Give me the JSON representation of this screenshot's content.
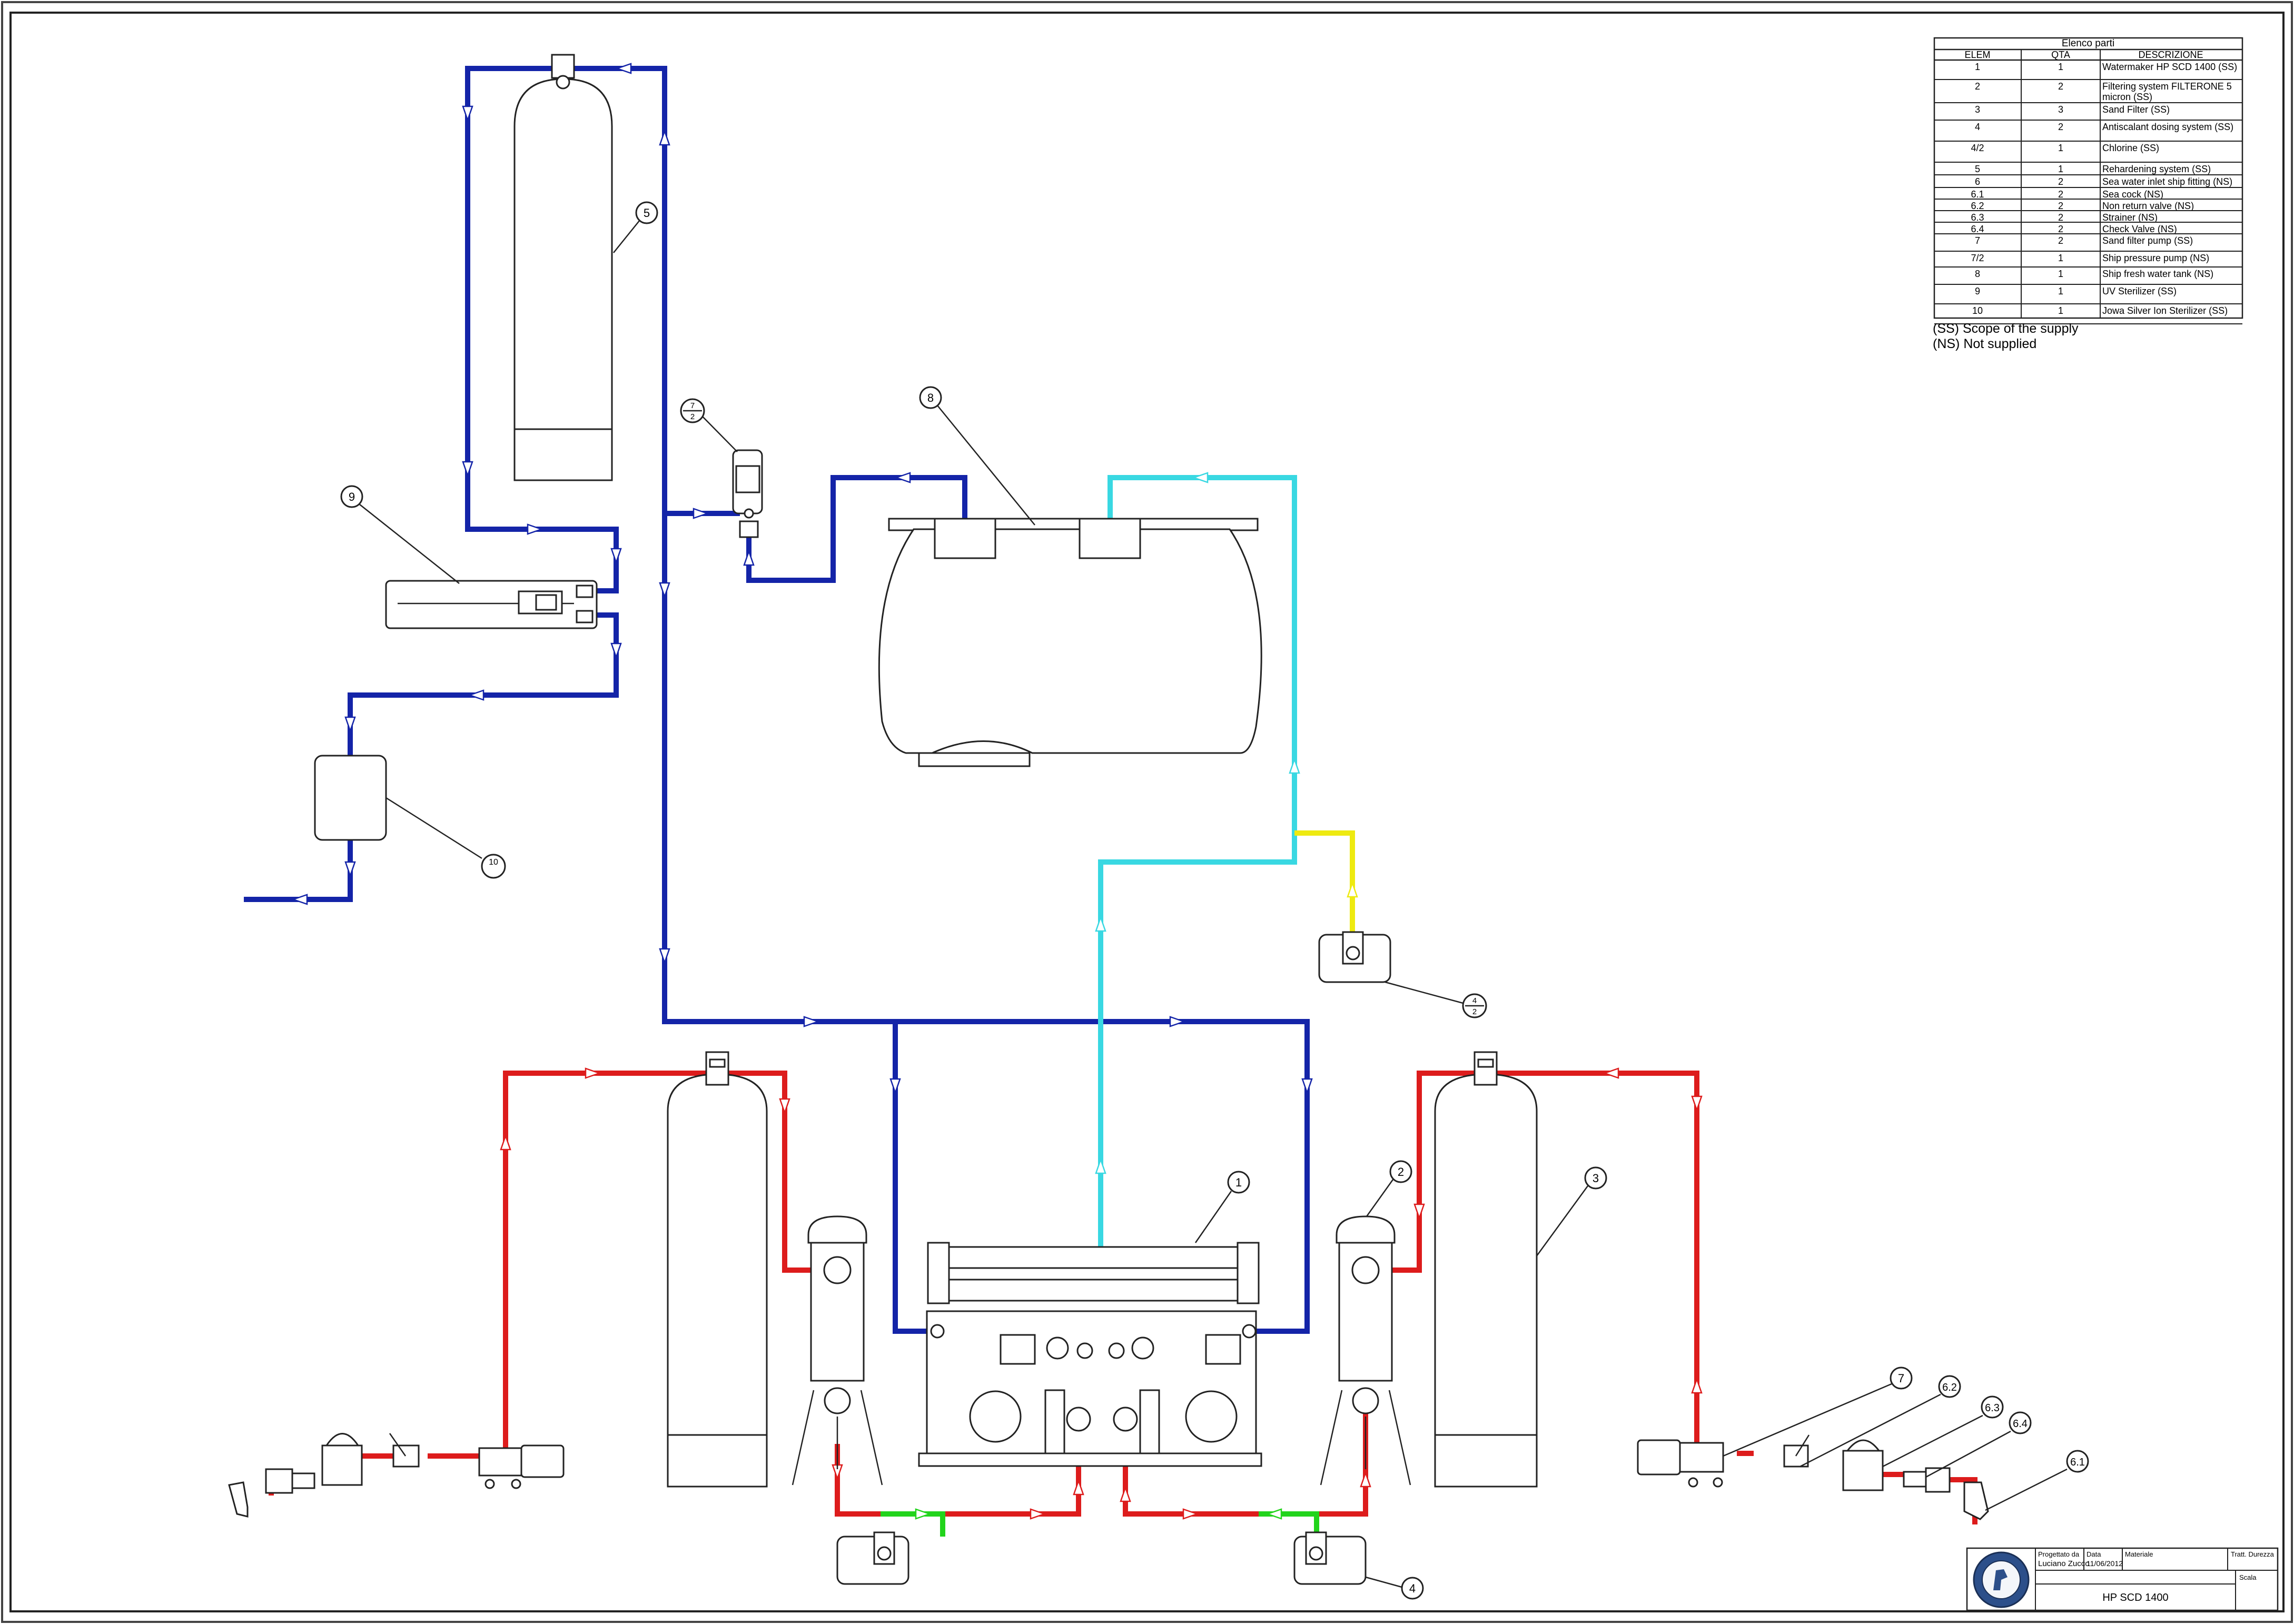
{
  "parts_table": {
    "title": "Elenco parti",
    "headers": [
      "ELEM",
      "QTA",
      "DESCRIZIONE"
    ],
    "rows": [
      {
        "elem": "1",
        "qta": "1",
        "desc": [
          "Watermaker HP SCD 1400  (SS)"
        ]
      },
      {
        "elem": "2",
        "qta": "2",
        "desc": [
          "Filtering system  FILTERONE 5",
          "micron  (SS)"
        ]
      },
      {
        "elem": "3",
        "qta": "3",
        "desc": [
          "Sand Filter  (SS)"
        ]
      },
      {
        "elem": "4",
        "qta": "2",
        "desc": [
          "Antiscalant dosing system  (SS)"
        ]
      },
      {
        "elem": "4/2",
        "qta": "1",
        "desc": [
          "Chlorine  (SS)"
        ]
      },
      {
        "elem": "5",
        "qta": "1",
        "desc": [
          "Rehardening system  (SS)"
        ]
      },
      {
        "elem": "6",
        "qta": "2",
        "desc": [
          "Sea water inlet ship fitting  (NS)"
        ]
      },
      {
        "elem": "6.1",
        "qta": "2",
        "desc": [
          "Sea cock  (NS)"
        ]
      },
      {
        "elem": "6.2",
        "qta": "2",
        "desc": [
          "Non return valve  (NS)"
        ]
      },
      {
        "elem": "6.3",
        "qta": "2",
        "desc": [
          " Strainer  (NS)"
        ]
      },
      {
        "elem": "6.4",
        "qta": "2",
        "desc": [
          "Check Valve  (NS)"
        ]
      },
      {
        "elem": "7",
        "qta": "2",
        "desc": [
          "Sand filter pump  (SS)"
        ]
      },
      {
        "elem": "7/2",
        "qta": "1",
        "desc": [
          "Ship pressure pump  (NS)"
        ]
      },
      {
        "elem": "8",
        "qta": "1",
        "desc": [
          "Ship fresh water tank  (NS)"
        ]
      },
      {
        "elem": "9",
        "qta": "1",
        "desc": [
          "UV Sterilizer  (SS)"
        ]
      },
      {
        "elem": "10",
        "qta": "1",
        "desc": [
          "Jowa Silver Ion Sterilizer  (SS)"
        ]
      }
    ]
  },
  "notes": [
    "(SS) Scope of the supply",
    "(NS) Not supplied"
  ],
  "balloons": {
    "b1": "1",
    "b2": "2",
    "b3": "3",
    "b4": "4",
    "b5": "5",
    "b7": "7",
    "b62": "6.2",
    "b63": "6.3",
    "b64": "6.4",
    "b61": "6.1",
    "b8": "8",
    "b9": "9",
    "b10": "10",
    "b72_top": "7",
    "b72_bottom": "2",
    "b42_top": "4",
    "b42_bottom": "2"
  },
  "title_block": {
    "designer_label": "Progettato da",
    "designer": "Luciano Zucco",
    "date_label": "Data",
    "date": "11/06/2012",
    "material_label": "Materiale",
    "treatment_label": "Tratt. Durezza",
    "drawing_title": "HP SCD 1400",
    "scale_label": "Scala"
  },
  "colors": {
    "fresh_water": "#1424a8",
    "sea_water": "#dd1c1c",
    "product_water": "#39d8e2",
    "chlorine": "#eeea10",
    "antiscalant": "#22d41c"
  }
}
